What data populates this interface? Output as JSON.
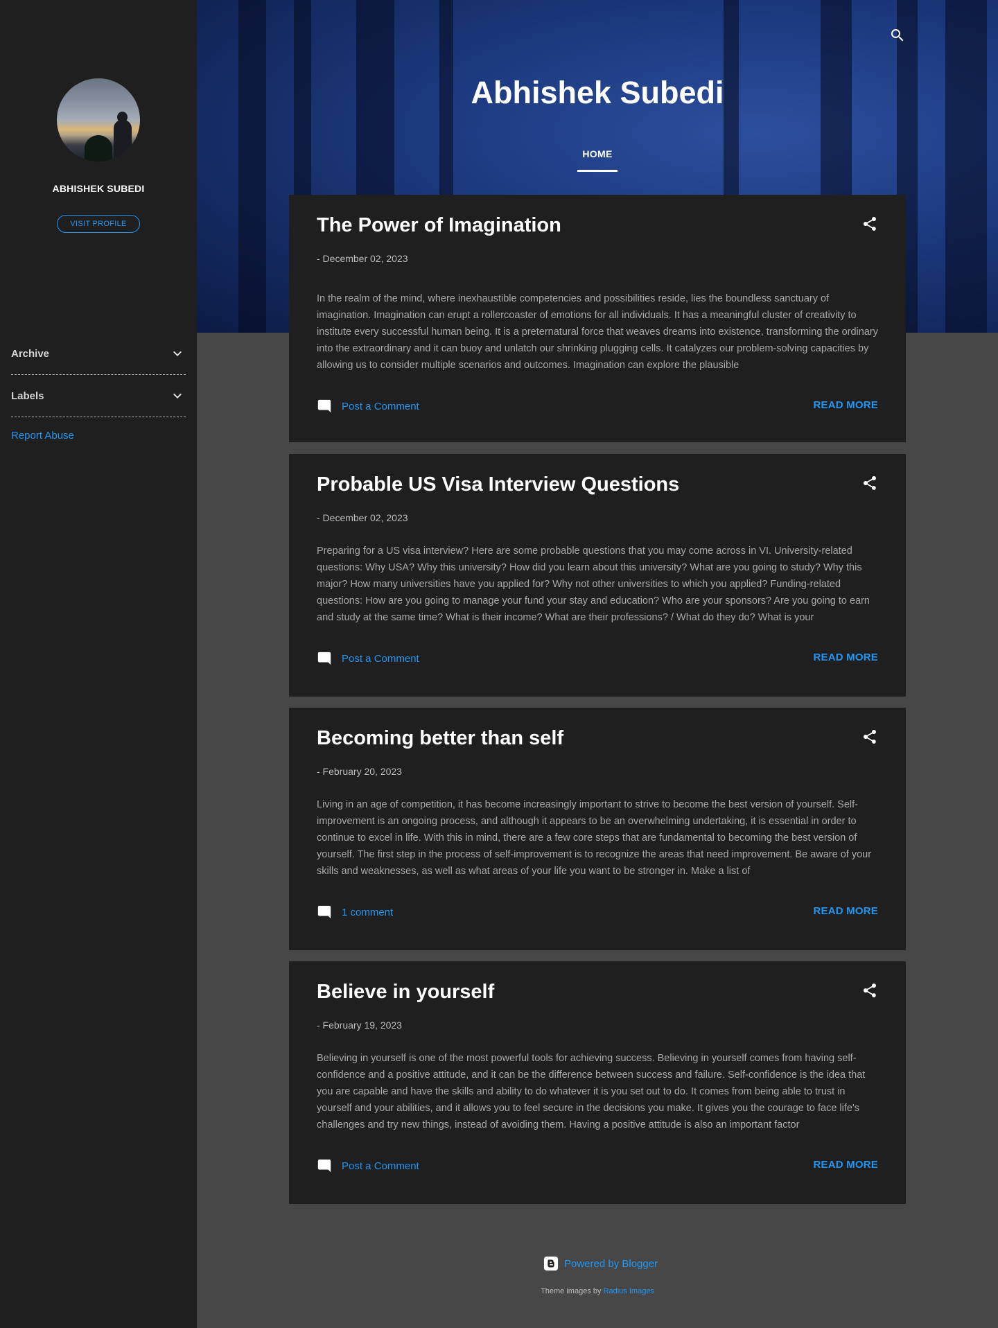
{
  "sidebar": {
    "profile_name": "ABHISHEK SUBEDI",
    "visit_profile": "VISIT PROFILE",
    "widgets": [
      {
        "label": "Archive",
        "icon": "chevron-down-icon"
      },
      {
        "label": "Labels",
        "icon": "chevron-down-icon"
      }
    ],
    "report_abuse": "Report Abuse"
  },
  "header": {
    "title": "Abhishek Subedi",
    "nav": [
      {
        "label": "HOME"
      }
    ],
    "search_icon": "search-icon"
  },
  "posts": [
    {
      "title": "The Power of Imagination",
      "date": "- December 02, 2023",
      "snippet": "In the realm of the mind, where inexhaustible competencies and possibilities reside, lies the boundless sanctuary of imagination. Imagination can erupt a rollercoaster of emotions for all individuals. It has a meaningful cluster of creativity to institute every successful human being. It is a preternatural force that weaves dreams into existence, transforming the ordinary into the extraordinary and it can buoy and unlatch our shrinking plugging cells. It catalyzes our problem-solving capacities by allowing us to consider multiple scenarios and outcomes. Imagination can explore the plausible",
      "comment_label": "Post a Comment",
      "read_more": "READ MORE"
    },
    {
      "title": "Probable US Visa Interview Questions",
      "date": "- December 02, 2023",
      "snippet": "  Preparing for a US visa interview? Here are some probable questions that you may come across in VI. University-related questions: Why USA? Why this university? How did you learn about this university? What are you going to study? Why this major? How many universities have you applied for? Why not other universities to which you applied?   Funding-related questions: How are you going to manage your fund your stay and education? Who are your sponsors? Are you going to earn and study at the same time? What is their income?  What are their professions? / What do they do? What is your",
      "comment_label": "Post a Comment",
      "read_more": "READ MORE"
    },
    {
      "title": "Becoming better than self",
      "date": "- February 20, 2023",
      "snippet": " Living in an age of competition, it has become increasingly important to strive to become the best version of yourself. Self-improvement is an ongoing process, and although it appears to be an overwhelming undertaking, it is essential in order to continue to excel in life. With this in mind, there are a few core steps that are fundamental to becoming the best version of yourself.   The first step in the process of self-improvement is to recognize the areas that need improvement. Be aware of your skills and weaknesses, as well as what areas of your life you want to be stronger in. Make a list of",
      "comment_label": "1 comment",
      "read_more": "READ MORE"
    },
    {
      "title": "Believe in yourself",
      "date": "- February 19, 2023",
      "snippet": "  Believing in yourself is one of the most powerful tools for achieving success. Believing in yourself comes from having self-confidence and a positive attitude, and it can be the difference between success and failure. Self-confidence is the idea that you are capable and have the skills and ability to do whatever it is you set out to do. It comes from being able to trust in yourself and your abilities, and it allows you to feel secure in the decisions you make. It gives you the courage to face life's challenges and try new things, instead of avoiding them.   Having a positive attitude is also an important factor",
      "comment_label": "Post a Comment",
      "read_more": "READ MORE"
    }
  ],
  "footer": {
    "powered_by": "Powered by Blogger",
    "theme_prefix": "Theme images by",
    "theme_link": "Radius Images"
  },
  "colors": {
    "accent": "#2196f3",
    "page_bg": "#474747",
    "card_bg": "#1f1f1f"
  }
}
